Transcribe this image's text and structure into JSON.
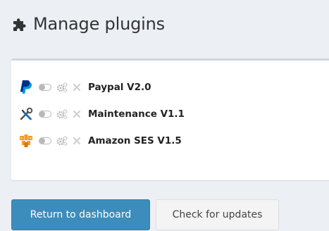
{
  "header": {
    "icon": "puzzle-icon",
    "title": "Manage plugins"
  },
  "plugins": [
    {
      "name": "Paypal V2.0",
      "logo": "paypal-icon",
      "color": "#003087"
    },
    {
      "name": "Maintenance V1.1",
      "logo": "wrench-screwdriver-icon",
      "color": "#1a6fb5"
    },
    {
      "name": "Amazon SES V1.5",
      "logo": "amazon-ses-icon",
      "color": "#f7981d"
    }
  ],
  "actions": {
    "return_label": "Return to dashboard",
    "update_label": "Check for updates"
  },
  "colors": {
    "primary": "#3c8dbc",
    "background": "#ecf0f5",
    "box_border": "#d2d6de",
    "muted_icon": "#b8b8b8"
  }
}
